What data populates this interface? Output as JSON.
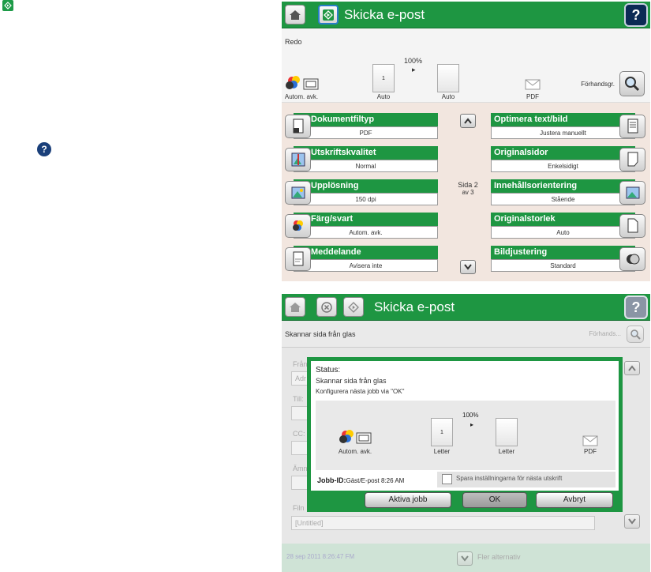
{
  "legend": {
    "start_icon": "start-icon",
    "help_icon": "help-icon",
    "help_glyph": "?"
  },
  "screen1": {
    "title": "Skicka e-post",
    "help": "?",
    "status": "Redo",
    "zoom": "100%",
    "arrow": "▸",
    "page_glyph": "1",
    "color_caption": "Autom. avk.",
    "size1_caption": "Auto",
    "size2_caption": "Auto",
    "format_caption": "PDF",
    "preview_label": "Förhandsgr.",
    "page_indicator": {
      "line1": "Sida 2",
      "line2": "av 3"
    },
    "options": [
      {
        "label": "Dokumentfiltyp",
        "value": "PDF",
        "icon": "document-type-icon"
      },
      {
        "label": "Utskriftskvalitet",
        "value": "Normal",
        "icon": "print-quality-icon"
      },
      {
        "label": "Upplösning",
        "value": "150 dpi",
        "icon": "resolution-icon"
      },
      {
        "label": "Färg/svart",
        "value": "Autom. avk.",
        "icon": "color-icon"
      },
      {
        "label": "Meddelande",
        "value": "Avisera inte",
        "icon": "notify-icon"
      },
      {
        "label": "Optimera text/bild",
        "value": "Justera manuellt",
        "icon": "optimize-icon"
      },
      {
        "label": "Originalsidor",
        "value": "Enkelsidigt",
        "icon": "original-sides-icon"
      },
      {
        "label": "Innehållsorientering",
        "value": "Stående",
        "icon": "orientation-icon"
      },
      {
        "label": "Originalstorlek",
        "value": "Auto",
        "icon": "original-size-icon"
      },
      {
        "label": "Bildjustering",
        "value": "Standard",
        "icon": "image-adjust-icon"
      }
    ]
  },
  "screen2": {
    "title": "Skicka e-post",
    "help": "?",
    "scanning": "Skannar sida från glas",
    "preview_label": "Förhands...",
    "bg_labels": {
      "from": "Från",
      "from_field": "Adr",
      "to": "Till:",
      "cc": "CC:",
      "subject": "Ämn",
      "file": "Filn",
      "untitled": "[Untitled]"
    },
    "date": "28 sep 2011 8:26:47 FM",
    "more_options": "Fler alternativ",
    "dialog": {
      "status_title": "Status:",
      "line1": "Skannar sida från glas",
      "line2": "Konfigurera nästa jobb via \"OK\"",
      "zoom": "100%",
      "color_caption": "Autom. avk.",
      "size1_caption": "Letter",
      "size2_caption": "Letter",
      "format_caption": "PDF",
      "job_label": "Jobb-ID:",
      "job_value": "Gäst/E-post 8:26 AM",
      "save_settings": "Spara inställningarna för nästa utskrift",
      "btn_active": "Aktiva jobb",
      "btn_ok": "OK",
      "btn_cancel": "Avbryt"
    }
  },
  "colors": {
    "accent": "#1e9642",
    "help": "#0b2a55",
    "options_bg": "#f2e6df"
  }
}
